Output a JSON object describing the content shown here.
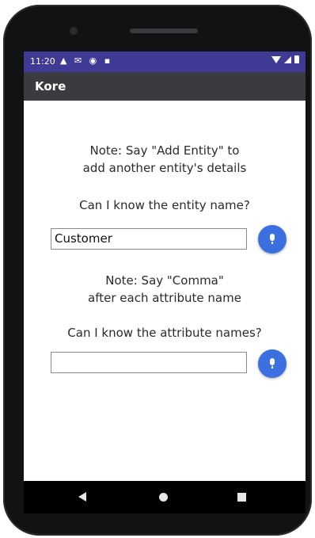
{
  "status_bar": {
    "time": "11:20",
    "left_icons": "▲ ✉ ◉ ▪",
    "right_icons": [
      "wifi-icon",
      "signal-icon",
      "battery-icon"
    ]
  },
  "app_bar": {
    "title": "Kore"
  },
  "entity_section": {
    "note_line1": "Note: Say \"Add Entity\" to",
    "note_line2": "add another entity's details",
    "question": "Can I know the entity name?",
    "input_value": "Customer"
  },
  "attribute_section": {
    "note_line1": "Note: Say \"Comma\"",
    "note_line2": "after each attribute name",
    "question": "Can I know the attribute names?",
    "input_value": ""
  },
  "colors": {
    "status_bar": "#3f3a94",
    "app_bar": "#3a3b3e",
    "mic_button": "#3c6fe0",
    "nav_bar": "#000000"
  },
  "nav_bar": {
    "buttons": [
      "back-icon",
      "home-icon",
      "recents-icon"
    ]
  }
}
